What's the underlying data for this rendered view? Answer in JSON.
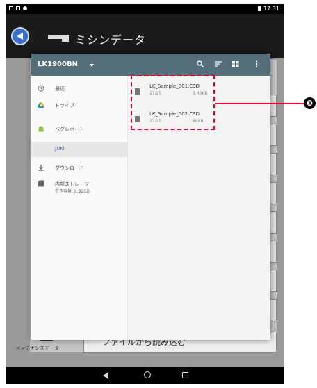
{
  "status_bar": {
    "time": "17:31"
  },
  "app_bar": {
    "title": "ミシンデータ"
  },
  "dialog": {
    "title": "LK1900BN",
    "toolbar_icons": [
      "search-icon",
      "sort-icon",
      "grid-view-icon",
      "more-vert-icon"
    ]
  },
  "drawer": {
    "items": [
      {
        "label": "最近",
        "icon": "clock-icon"
      },
      {
        "label": "ドライブ",
        "icon": "drive-icon"
      },
      {
        "label": "バグレポート",
        "icon": "android-icon"
      },
      {
        "label": "JUKI",
        "icon": ""
      },
      {
        "label": "ダウンロード",
        "icon": "download-icon"
      },
      {
        "label": "内部ストレージ",
        "sub": "空き容量: 6.92GB",
        "icon": "sd-card-icon"
      }
    ]
  },
  "files": [
    {
      "name": "LK_Sample_001.CSD",
      "time": "17:25",
      "size": "3.43KB"
    },
    {
      "name": "LK_Sample_002.CSD",
      "time": "17:25",
      "size": "868B"
    }
  ],
  "background": {
    "maintenance_label": "メンテナンスデータ",
    "load_button": "ファイルから読み込む"
  },
  "callout": {
    "number": "❸"
  },
  "colors": {
    "toolbar": "#546e7a",
    "accent": "#3d6fc8",
    "highlight": "#e4002b"
  }
}
